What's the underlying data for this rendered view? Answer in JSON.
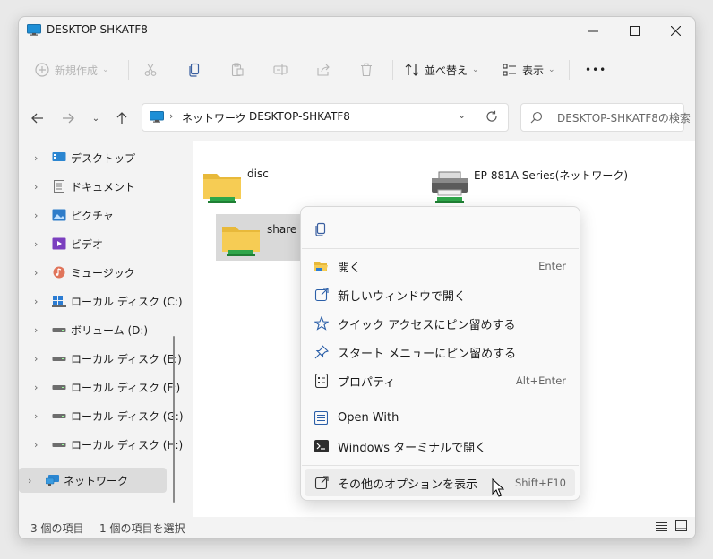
{
  "window": {
    "title": "DESKTOP-SHKATF8"
  },
  "toolbar": {
    "new_label": "新規作成",
    "sort_label": "並べ替え",
    "view_label": "表示",
    "more_label": "•••"
  },
  "address": {
    "crumbs": [
      "ネットワーク",
      "DESKTOP-SHKATF8"
    ],
    "search_placeholder": "DESKTOP-SHKATF8の検索"
  },
  "sidebar": {
    "items": [
      {
        "label": "デスクトップ",
        "icon": "desktop-icon"
      },
      {
        "label": "ドキュメント",
        "icon": "documents-icon"
      },
      {
        "label": "ピクチャ",
        "icon": "pictures-icon"
      },
      {
        "label": "ビデオ",
        "icon": "videos-icon"
      },
      {
        "label": "ミュージック",
        "icon": "music-icon"
      },
      {
        "label": "ローカル ディスク (C:)",
        "icon": "drive-icon"
      },
      {
        "label": "ボリューム (D:)",
        "icon": "drive-icon"
      },
      {
        "label": "ローカル ディスク (E:)",
        "icon": "drive-icon"
      },
      {
        "label": "ローカル ディスク (F:)",
        "icon": "drive-icon"
      },
      {
        "label": "ローカル ディスク (G:)",
        "icon": "drive-icon"
      },
      {
        "label": "ローカル ディスク (H:)",
        "icon": "drive-icon"
      },
      {
        "label": "ネットワーク",
        "icon": "network-icon"
      }
    ]
  },
  "content": {
    "items": [
      {
        "label": "disc",
        "icon": "shared-folder-icon"
      },
      {
        "label": "EP-881A Series(ネットワーク)",
        "icon": "printer-icon"
      },
      {
        "label": "share",
        "icon": "shared-folder-icon"
      }
    ]
  },
  "context_menu": {
    "top_icon": "copy-icon",
    "items": [
      {
        "label": "開く",
        "shortcut": "Enter",
        "icon": "folder-open-icon"
      },
      {
        "label": "新しいウィンドウで開く",
        "shortcut": "",
        "icon": "open-new-window-icon"
      },
      {
        "label": "クイック アクセスにピン留めする",
        "shortcut": "",
        "icon": "star-icon"
      },
      {
        "label": "スタート メニューにピン留めする",
        "shortcut": "",
        "icon": "pin-icon"
      },
      {
        "label": "プロパティ",
        "shortcut": "Alt+Enter",
        "icon": "properties-icon"
      },
      {
        "label": "Open With",
        "shortcut": "",
        "icon": "open-with-icon"
      },
      {
        "label": "Windows ターミナルで開く",
        "shortcut": "",
        "icon": "terminal-icon"
      },
      {
        "label": "その他のオプションを表示",
        "shortcut": "Shift+F10",
        "icon": "more-options-icon"
      }
    ]
  },
  "status": {
    "item_count": "3 個の項目",
    "selected": "1 個の項目を選択"
  }
}
